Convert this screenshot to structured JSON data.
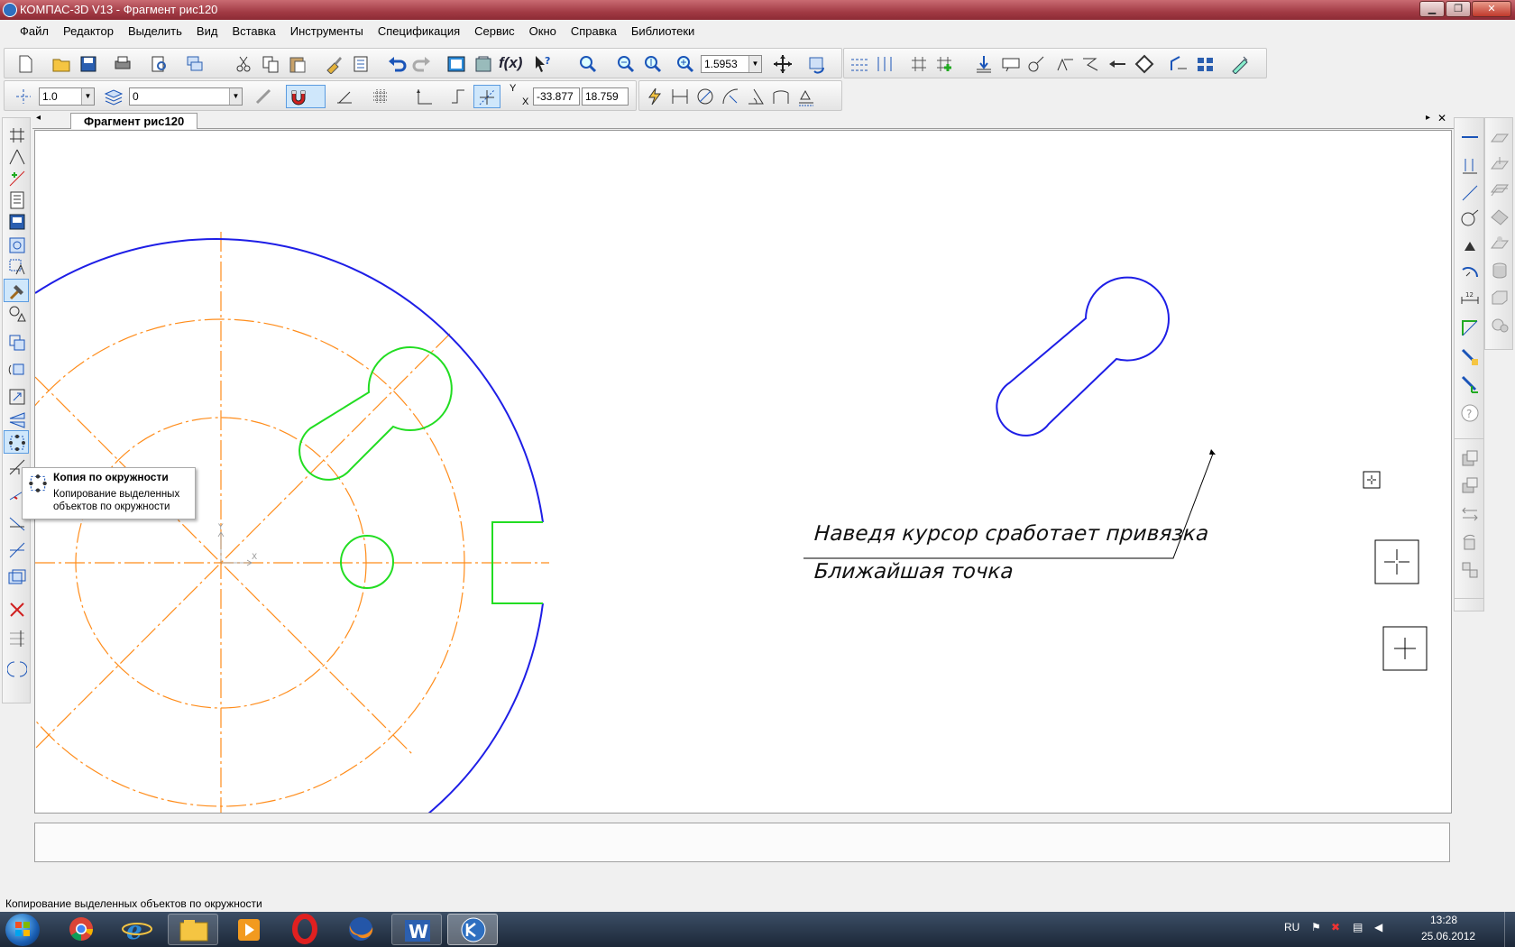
{
  "window": {
    "title": "КОМПАС-3D V13 - Фрагмент рис120"
  },
  "menu": [
    "Файл",
    "Редактор",
    "Выделить",
    "Вид",
    "Вставка",
    "Инструменты",
    "Спецификация",
    "Сервис",
    "Окно",
    "Справка",
    "Библиотеки"
  ],
  "toolbar": {
    "zoom_value": "1.5953",
    "line_style": "1.0",
    "layer": "0",
    "coord_y_label": "Y",
    "coord_x_label": "X",
    "coord_x": "-33.877",
    "coord_y": "18.759"
  },
  "document_tab": "Фрагмент рис120",
  "tooltip": {
    "title": "Копия по окружности",
    "description": "Копирование выделенных объектов по окружности"
  },
  "annotation": {
    "line1": "Наведя курсор сработает привязка",
    "line2": "Ближайшая точка"
  },
  "status": "Копирование выделенных объектов по окружности",
  "tray": {
    "lang": "RU",
    "time": "13:28",
    "date": "25.06.2012"
  },
  "colors": {
    "contour": "#1e1ee6",
    "selected": "#22dd22",
    "axis": "#ff8c1a",
    "title_bar": "#a23b45"
  }
}
